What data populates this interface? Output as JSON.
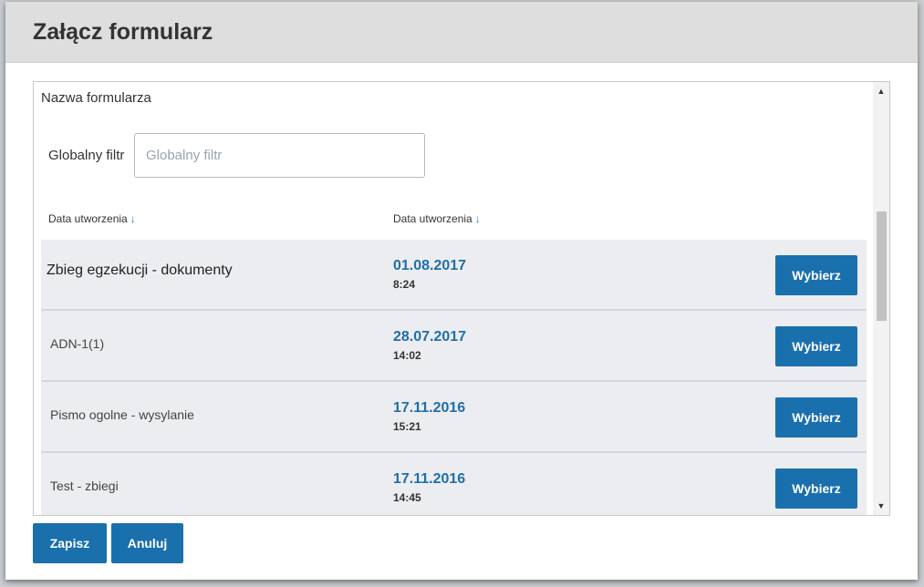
{
  "modal": {
    "title": "Załącz formularz"
  },
  "panel": {
    "heading": "Nazwa formularza",
    "filter": {
      "label": "Globalny filtr",
      "placeholder": "Globalny filtr",
      "value": ""
    },
    "columns": [
      {
        "label": "Data utworzenia",
        "sort_icon": "arrow-down-icon"
      },
      {
        "label": "Data utworzenia",
        "sort_icon": "arrow-down-icon"
      }
    ],
    "rows": [
      {
        "name": "Zbieg egzekucji - dokumenty",
        "date": "01.08.2017",
        "time": "8:24",
        "button": "Wybierz"
      },
      {
        "name": "ADN-1(1)",
        "date": "28.07.2017",
        "time": "14:02",
        "button": "Wybierz"
      },
      {
        "name": "Pismo ogolne - wysylanie",
        "date": "17.11.2016",
        "time": "15:21",
        "button": "Wybierz"
      },
      {
        "name": "Test - zbiegi",
        "date": "17.11.2016",
        "time": "14:45",
        "button": "Wybierz"
      }
    ]
  },
  "footer": {
    "save_label": "Zapisz",
    "cancel_label": "Anuluj"
  },
  "colors": {
    "accent": "#1a6fad",
    "date_text": "#1f6fa8",
    "row_bg": "#ebedf0",
    "header_bg": "#dedede"
  }
}
